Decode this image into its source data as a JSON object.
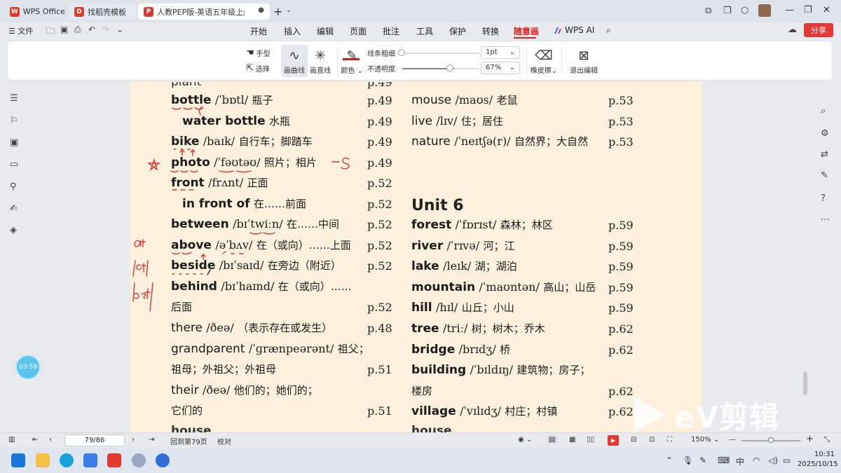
{
  "tabs": [
    {
      "label": "WPS Office",
      "icon": "wps-logo-icon"
    },
    {
      "label": "找稻壳模板",
      "icon": "docer-icon"
    },
    {
      "label": "人教PEP版-英语五年级上册.pdf",
      "icon": "pdf-icon"
    }
  ],
  "menubar": {
    "file_label": "文件",
    "items": [
      "开始",
      "插入",
      "编辑",
      "页面",
      "批注",
      "工具",
      "保护",
      "转换",
      "随意画",
      "WPS AI"
    ],
    "active_item": "随意画",
    "share_label": "分享"
  },
  "ribbon": {
    "hand_label": "手型",
    "select_label": "选择",
    "curve_label": "画曲线",
    "line_label": "画直线",
    "color_label": "颜色",
    "line_width_label": "线条粗细",
    "line_width_value": "1pt",
    "opacity_label": "不透明度",
    "opacity_value": "67%",
    "opacity_fraction": 0.67,
    "eraser_label": "橡皮擦",
    "exit_label": "退出编辑",
    "pen_color": "#c62020"
  },
  "timer": "03:59",
  "doc": {
    "left_entries": [
      {
        "word": "bottle",
        "phon": "/ˈbɒtl/",
        "cn": "瓶子",
        "page": "p.49"
      },
      {
        "word": "water bottle",
        "phon": "",
        "cn": "水瓶",
        "page": "p.49"
      },
      {
        "word": "bike",
        "phon": "/baɪk/",
        "cn": "自行车；脚踏车",
        "page": "p.49"
      },
      {
        "word": "photo",
        "phon": "/ˈfəʊtəʊ/",
        "cn": "照片；相片",
        "page": "p.49"
      },
      {
        "word": "front",
        "phon": "/frʌnt/",
        "cn": "正面",
        "page": "p.52"
      },
      {
        "word": "in front of",
        "phon": "",
        "cn": "在……前面",
        "page": "p.52"
      },
      {
        "word": "between",
        "phon": "/bɪˈtwiːn/",
        "cn": "在……中间",
        "page": "p.52"
      },
      {
        "word": "above",
        "phon": "/əˈbʌv/",
        "cn": "在（或向）……上面",
        "page": "p.52"
      },
      {
        "word": "beside",
        "phon": "/bɪˈsaɪd/",
        "cn": "在旁边（附近）",
        "page": "p.52"
      },
      {
        "word": "behind",
        "phon": "/bɪˈhaɪnd/",
        "cn": "在（或向）……",
        "page": ""
      },
      {
        "word": "",
        "phon": "",
        "cn": "后面",
        "page": "p.52"
      },
      {
        "word": "there",
        "phon": "/ðeə/",
        "cn": "（表示存在或发生）",
        "page": "p.48"
      },
      {
        "word": "grandparent",
        "phon": "/ˈɡrænpeərənt/",
        "cn": "祖父；",
        "page": ""
      },
      {
        "word": "",
        "phon": "",
        "cn": "祖母；外祖父；外祖母",
        "page": "p.51"
      },
      {
        "word": "their",
        "phon": "/ðeə/",
        "cn": "他们的；她们的；",
        "page": ""
      },
      {
        "word": "",
        "phon": "",
        "cn": "它们的",
        "page": "p.51"
      }
    ],
    "right_entries_top": [
      {
        "word": "mouse",
        "phon": "/maʊs/",
        "cn": "老鼠",
        "page": "p.53"
      },
      {
        "word": "live",
        "phon": "/lɪv/",
        "cn": "住；居住",
        "page": "p.53"
      },
      {
        "word": "nature",
        "phon": "/ˈneɪtʃə(r)/",
        "cn": "自然界；大自然",
        "page": "p.53"
      }
    ],
    "unit_heading": "Unit 6",
    "right_entries": [
      {
        "word": "forest",
        "phon": "/ˈfɒrɪst/",
        "cn": "森林；林区",
        "page": "p.59"
      },
      {
        "word": "river",
        "phon": "/ˈrɪvə/",
        "cn": "河；江",
        "page": "p.59"
      },
      {
        "word": "lake",
        "phon": "/leɪk/",
        "cn": "湖；湖泊",
        "page": "p.59"
      },
      {
        "word": "mountain",
        "phon": "/ˈmaʊntən/",
        "cn": "高山；山岳",
        "page": "p.59"
      },
      {
        "word": "hill",
        "phon": "/hɪl/",
        "cn": "山丘；小山",
        "page": "p.59"
      },
      {
        "word": "tree",
        "phon": "/triː/",
        "cn": "树；树木；乔木",
        "page": "p.62"
      },
      {
        "word": "bridge",
        "phon": "/brɪdʒ/",
        "cn": "桥",
        "page": "p.62"
      },
      {
        "word": "building",
        "phon": "/ˈbɪldɪŋ/",
        "cn": "建筑物；房子；",
        "page": ""
      },
      {
        "word": "",
        "phon": "",
        "cn": "楼房",
        "page": "p.62"
      },
      {
        "word": "village",
        "phon": "/ˈvɪlɪdʒ/",
        "cn": "村庄；村镇",
        "page": "p.62"
      }
    ],
    "handwriting": {
      "left_margin": [
        "at",
        "/ət/",
        "bet/"
      ],
      "photo_note": "-s"
    }
  },
  "status": {
    "page_indicator": "79/86",
    "goto_label": "回到第79页",
    "proof_label": "校对",
    "zoom": "150%"
  },
  "taskbar": {
    "time": "10:31",
    "date": "2025/10/15"
  },
  "watermark": "eV剪辑"
}
